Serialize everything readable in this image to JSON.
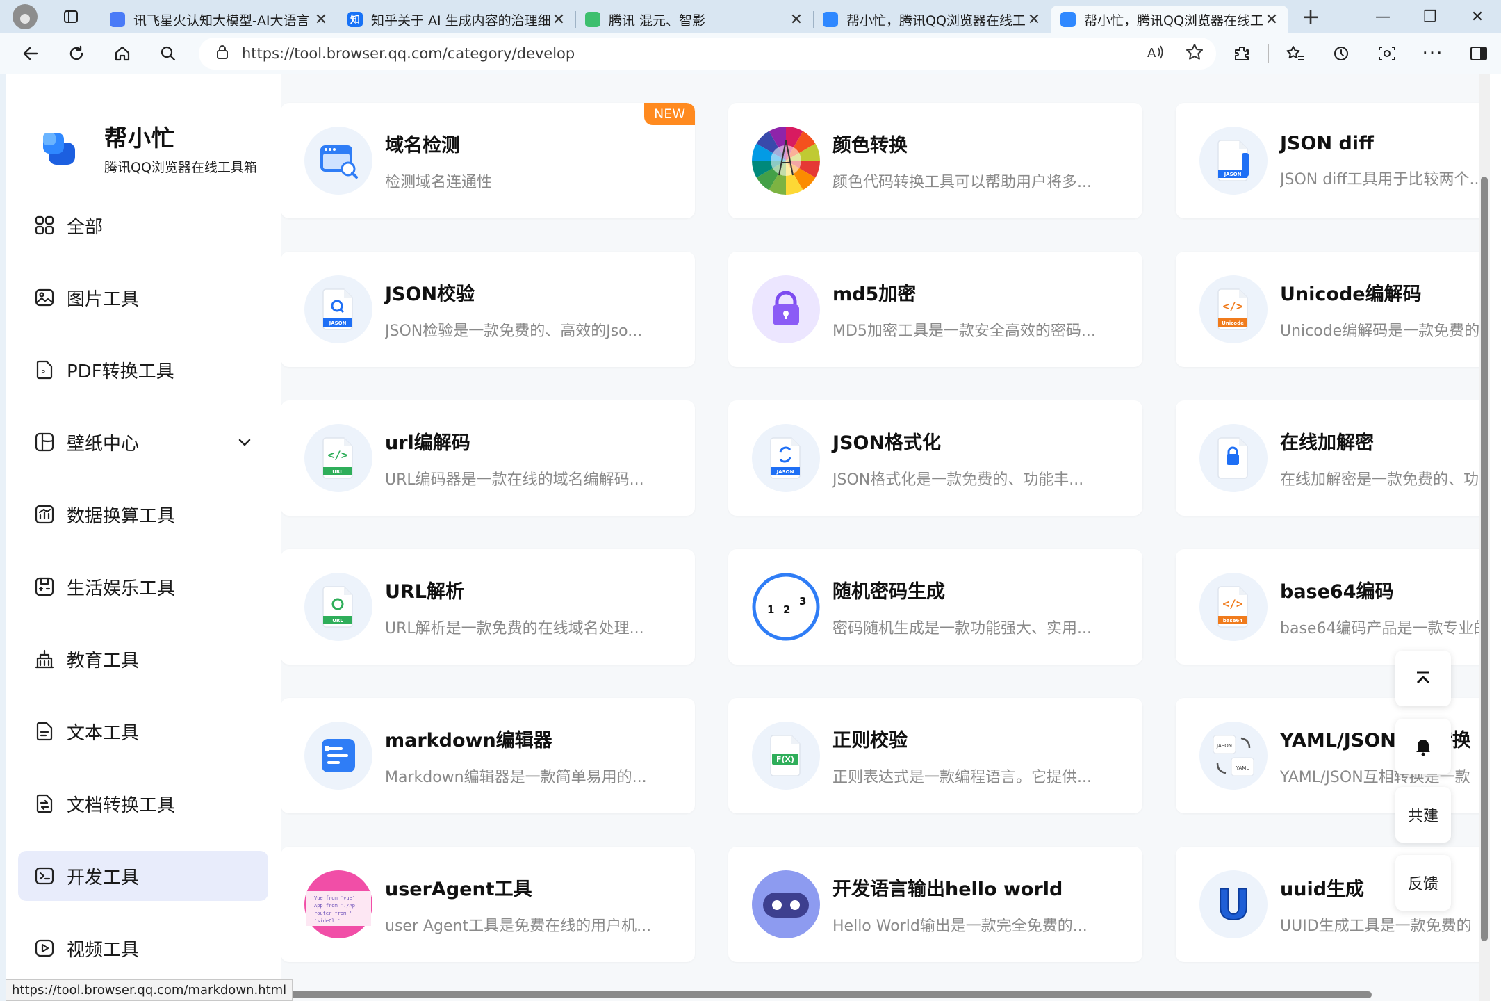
{
  "tabs": [
    {
      "title": "讯飞星火认知大模型-AI大语言",
      "color": "#4a7bf7",
      "active": false
    },
    {
      "title": "知乎关于 AI 生成内容的治理细",
      "color": "#1772f6",
      "glyph": "知",
      "active": false
    },
    {
      "title": "腾讯 混元、智影",
      "color": "#3dbf6e",
      "active": false
    },
    {
      "title": "帮小忙，腾讯QQ浏览器在线工",
      "color": "#2f88ff",
      "active": false
    },
    {
      "title": "帮小忙，腾讯QQ浏览器在线工",
      "color": "#2f88ff",
      "active": true
    }
  ],
  "address": {
    "url": "https://tool.browser.qq.com/category/develop"
  },
  "brand": {
    "name": "帮小忙",
    "subtitle": "腾讯QQ浏览器在线工具箱"
  },
  "nav": [
    {
      "label": "全部",
      "icon": "grid-icon"
    },
    {
      "label": "图片工具",
      "icon": "image-icon"
    },
    {
      "label": "PDF转换工具",
      "icon": "pdf-icon"
    },
    {
      "label": "壁纸中心",
      "icon": "wallpaper-icon",
      "expandable": true
    },
    {
      "label": "数据换算工具",
      "icon": "chart-icon"
    },
    {
      "label": "生活娱乐工具",
      "icon": "game-icon"
    },
    {
      "label": "教育工具",
      "icon": "building-icon"
    },
    {
      "label": "文本工具",
      "icon": "text-icon"
    },
    {
      "label": "文档转换工具",
      "icon": "doc-convert-icon"
    },
    {
      "label": "开发工具",
      "icon": "terminal-icon",
      "active": true
    },
    {
      "label": "视频工具",
      "icon": "video-icon"
    }
  ],
  "cards": [
    {
      "title": "域名检测",
      "desc": "检测域名连通性",
      "icon": "domain-check-icon",
      "badge": "NEW"
    },
    {
      "title": "颜色转换",
      "desc": "颜色代码转换工具可以帮助用户将多...",
      "icon": "color-wheel-icon"
    },
    {
      "title": "JSON diff",
      "desc": "JSON diff工具用于比较两个...",
      "icon": "json-diff-icon",
      "tag": "JASON"
    },
    {
      "title": "JSON校验",
      "desc": "JSON检验是一款免费的、高效的Jso...",
      "icon": "json-check-icon",
      "tag": "JASON"
    },
    {
      "title": "md5加密",
      "desc": "MD5加密工具是一款安全高效的密码...",
      "icon": "lock-purple-icon"
    },
    {
      "title": "Unicode编解码",
      "desc": "Unicode编解码是一款免费的",
      "icon": "unicode-icon",
      "tag": "Unicode"
    },
    {
      "title": "url编解码",
      "desc": "URL编码器是一款在线的域名编解码...",
      "icon": "url-code-icon",
      "tag": "URL"
    },
    {
      "title": "JSON格式化",
      "desc": "JSON格式化是一款免费的、功能丰...",
      "icon": "json-format-icon",
      "tag": "JASON"
    },
    {
      "title": "在线加解密",
      "desc": "在线加解密是一款免费的、功",
      "icon": "lock-file-icon"
    },
    {
      "title": "URL解析",
      "desc": "URL解析是一款免费的在线域名处理...",
      "icon": "url-parse-icon",
      "tag": "URL"
    },
    {
      "title": "随机密码生成",
      "desc": "密码随机生成是一款功能强大、实用...",
      "icon": "random-password-icon",
      "digits": "1 2 3"
    },
    {
      "title": "base64编码",
      "desc": "base64编码产品是一款专业的",
      "icon": "base64-icon",
      "tag": "base64"
    },
    {
      "title": "markdown编辑器",
      "desc": "Markdown编辑器是一款简单易用的...",
      "icon": "markdown-icon"
    },
    {
      "title": "正则校验",
      "desc": "正则表达式是一款编程语言。它提供...",
      "icon": "regex-icon",
      "tag": "F(X)"
    },
    {
      "title": "YAML/JSON互相转换",
      "desc": "YAML/JSON互相转换是一款",
      "icon": "yaml-json-icon",
      "tag": "JASON",
      "tag2": "YAML"
    },
    {
      "title": "userAgent工具",
      "desc": "user Agent工具是免费在线的用户机...",
      "icon": "useragent-icon",
      "code": [
        "Vue from 'vue'",
        "App from './Ap",
        "router from '",
        "'sideCli'"
      ]
    },
    {
      "title": "开发语言输出hello world",
      "desc": "Hello World输出是一款完全免费的...",
      "icon": "robot-icon"
    },
    {
      "title": "uuid生成",
      "desc": "UUID生成工具是一款免费的",
      "icon": "uuid-icon",
      "letter": "U"
    }
  ],
  "float_buttons": {
    "cobuild": "共建",
    "feedback": "反馈"
  },
  "status_bar": {
    "url": "https://tool.browser.qq.com/markdown.html"
  },
  "colors": {
    "accent": "#2f88ff",
    "new_badge": "#ff8a1f",
    "nav_active": "#e8ecfb"
  }
}
